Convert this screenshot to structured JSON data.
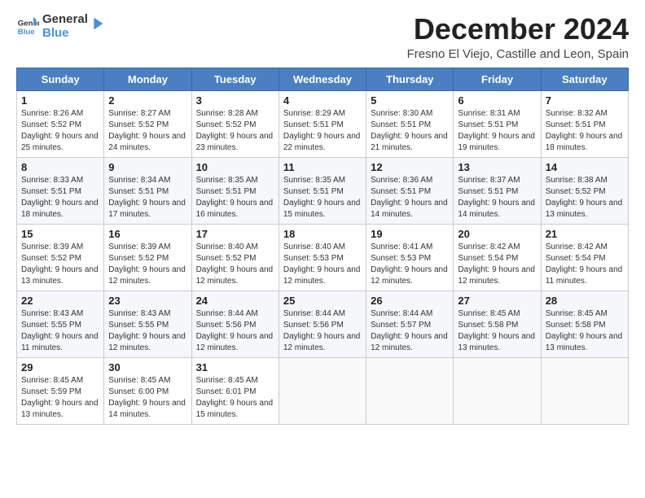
{
  "logo": {
    "general": "General",
    "blue": "Blue"
  },
  "header": {
    "month": "December 2024",
    "location": "Fresno El Viejo, Castille and Leon, Spain"
  },
  "weekdays": [
    "Sunday",
    "Monday",
    "Tuesday",
    "Wednesday",
    "Thursday",
    "Friday",
    "Saturday"
  ],
  "weeks": [
    [
      {
        "day": "1",
        "sunrise": "8:26 AM",
        "sunset": "5:52 PM",
        "daylight": "9 hours and 25 minutes."
      },
      {
        "day": "2",
        "sunrise": "8:27 AM",
        "sunset": "5:52 PM",
        "daylight": "9 hours and 24 minutes."
      },
      {
        "day": "3",
        "sunrise": "8:28 AM",
        "sunset": "5:52 PM",
        "daylight": "9 hours and 23 minutes."
      },
      {
        "day": "4",
        "sunrise": "8:29 AM",
        "sunset": "5:51 PM",
        "daylight": "9 hours and 22 minutes."
      },
      {
        "day": "5",
        "sunrise": "8:30 AM",
        "sunset": "5:51 PM",
        "daylight": "9 hours and 21 minutes."
      },
      {
        "day": "6",
        "sunrise": "8:31 AM",
        "sunset": "5:51 PM",
        "daylight": "9 hours and 19 minutes."
      },
      {
        "day": "7",
        "sunrise": "8:32 AM",
        "sunset": "5:51 PM",
        "daylight": "9 hours and 18 minutes."
      }
    ],
    [
      {
        "day": "8",
        "sunrise": "8:33 AM",
        "sunset": "5:51 PM",
        "daylight": "9 hours and 18 minutes."
      },
      {
        "day": "9",
        "sunrise": "8:34 AM",
        "sunset": "5:51 PM",
        "daylight": "9 hours and 17 minutes."
      },
      {
        "day": "10",
        "sunrise": "8:35 AM",
        "sunset": "5:51 PM",
        "daylight": "9 hours and 16 minutes."
      },
      {
        "day": "11",
        "sunrise": "8:35 AM",
        "sunset": "5:51 PM",
        "daylight": "9 hours and 15 minutes."
      },
      {
        "day": "12",
        "sunrise": "8:36 AM",
        "sunset": "5:51 PM",
        "daylight": "9 hours and 14 minutes."
      },
      {
        "day": "13",
        "sunrise": "8:37 AM",
        "sunset": "5:51 PM",
        "daylight": "9 hours and 14 minutes."
      },
      {
        "day": "14",
        "sunrise": "8:38 AM",
        "sunset": "5:52 PM",
        "daylight": "9 hours and 13 minutes."
      }
    ],
    [
      {
        "day": "15",
        "sunrise": "8:39 AM",
        "sunset": "5:52 PM",
        "daylight": "9 hours and 13 minutes."
      },
      {
        "day": "16",
        "sunrise": "8:39 AM",
        "sunset": "5:52 PM",
        "daylight": "9 hours and 12 minutes."
      },
      {
        "day": "17",
        "sunrise": "8:40 AM",
        "sunset": "5:52 PM",
        "daylight": "9 hours and 12 minutes."
      },
      {
        "day": "18",
        "sunrise": "8:40 AM",
        "sunset": "5:53 PM",
        "daylight": "9 hours and 12 minutes."
      },
      {
        "day": "19",
        "sunrise": "8:41 AM",
        "sunset": "5:53 PM",
        "daylight": "9 hours and 12 minutes."
      },
      {
        "day": "20",
        "sunrise": "8:42 AM",
        "sunset": "5:54 PM",
        "daylight": "9 hours and 12 minutes."
      },
      {
        "day": "21",
        "sunrise": "8:42 AM",
        "sunset": "5:54 PM",
        "daylight": "9 hours and 11 minutes."
      }
    ],
    [
      {
        "day": "22",
        "sunrise": "8:43 AM",
        "sunset": "5:55 PM",
        "daylight": "9 hours and 11 minutes."
      },
      {
        "day": "23",
        "sunrise": "8:43 AM",
        "sunset": "5:55 PM",
        "daylight": "9 hours and 12 minutes."
      },
      {
        "day": "24",
        "sunrise": "8:44 AM",
        "sunset": "5:56 PM",
        "daylight": "9 hours and 12 minutes."
      },
      {
        "day": "25",
        "sunrise": "8:44 AM",
        "sunset": "5:56 PM",
        "daylight": "9 hours and 12 minutes."
      },
      {
        "day": "26",
        "sunrise": "8:44 AM",
        "sunset": "5:57 PM",
        "daylight": "9 hours and 12 minutes."
      },
      {
        "day": "27",
        "sunrise": "8:45 AM",
        "sunset": "5:58 PM",
        "daylight": "9 hours and 13 minutes."
      },
      {
        "day": "28",
        "sunrise": "8:45 AM",
        "sunset": "5:58 PM",
        "daylight": "9 hours and 13 minutes."
      }
    ],
    [
      {
        "day": "29",
        "sunrise": "8:45 AM",
        "sunset": "5:59 PM",
        "daylight": "9 hours and 13 minutes."
      },
      {
        "day": "30",
        "sunrise": "8:45 AM",
        "sunset": "6:00 PM",
        "daylight": "9 hours and 14 minutes."
      },
      {
        "day": "31",
        "sunrise": "8:45 AM",
        "sunset": "6:01 PM",
        "daylight": "9 hours and 15 minutes."
      },
      null,
      null,
      null,
      null
    ]
  ]
}
